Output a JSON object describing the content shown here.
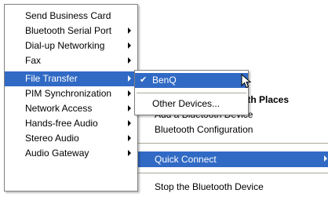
{
  "left_menu": {
    "items": [
      {
        "label": "Send Business Card",
        "has_submenu": false
      },
      {
        "label": "Bluetooth Serial Port",
        "has_submenu": true
      },
      {
        "label": "Dial-up Networking",
        "has_submenu": true
      },
      {
        "label": "Fax",
        "has_submenu": true
      },
      {
        "label": "File Transfer",
        "has_submenu": true,
        "highlighted": true
      },
      {
        "label": "PIM Synchronization",
        "has_submenu": true
      },
      {
        "label": "Network Access",
        "has_submenu": true
      },
      {
        "label": "Hands-free Audio",
        "has_submenu": true
      },
      {
        "label": "Stereo Audio",
        "has_submenu": true
      },
      {
        "label": "Audio Gateway",
        "has_submenu": true
      }
    ]
  },
  "submenu": {
    "items": [
      {
        "label": "BenQ",
        "checked": true,
        "highlighted": true
      },
      {
        "label": "Other Devices..."
      }
    ]
  },
  "main_menu": {
    "partial_header": "oth Places",
    "items": [
      {
        "label": "Add a Bluetooth Device"
      },
      {
        "label": "Bluetooth Configuration"
      },
      {
        "label": "Quick Connect",
        "has_submenu": true,
        "highlighted": true
      },
      {
        "label": "Stop the Bluetooth Device"
      }
    ]
  },
  "colors": {
    "highlight": "#316ac5",
    "menu_bg": "#ffffff",
    "separator": "#aca899"
  },
  "icons": {
    "check": "check-icon",
    "submenu_arrow": "submenu-arrow-icon",
    "cursor": "mouse-pointer-icon"
  }
}
